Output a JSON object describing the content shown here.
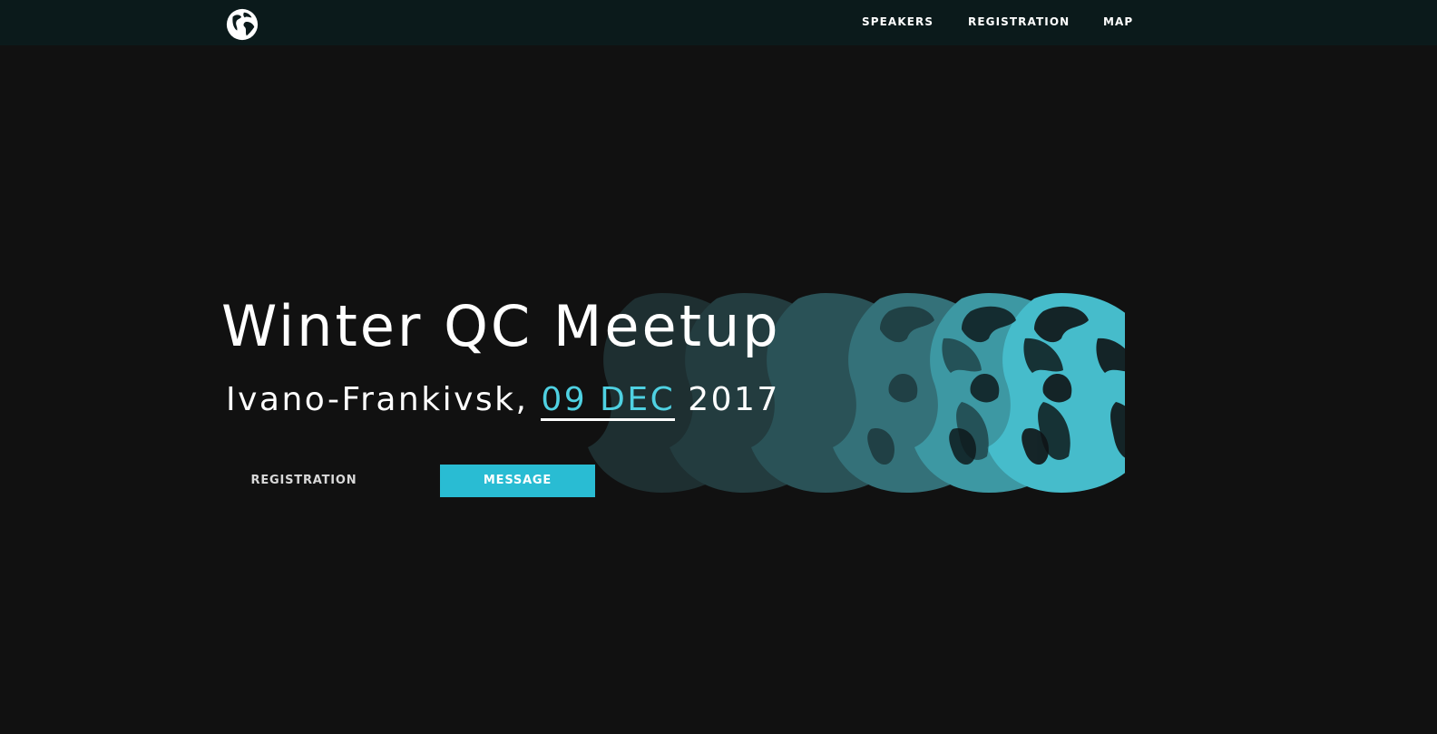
{
  "header": {
    "logo_icon": "globe-icon",
    "nav": {
      "speakers": "SPEAKERS",
      "registration": "REGISTRATION",
      "map": "MAP"
    }
  },
  "hero": {
    "title": "Winter QC Meetup",
    "city": "Ivano-Frankivsk,",
    "date": "09 DEC",
    "year": "2017",
    "buttons": {
      "registration": "REGISTRATION",
      "message": "MESSAGE"
    },
    "background_icon": "globe-rotation-graphic"
  },
  "colors": {
    "background": "#111111",
    "header": "#0b1a1b",
    "accent": "#29bcd3",
    "date_highlight": "#4fd1e2"
  }
}
